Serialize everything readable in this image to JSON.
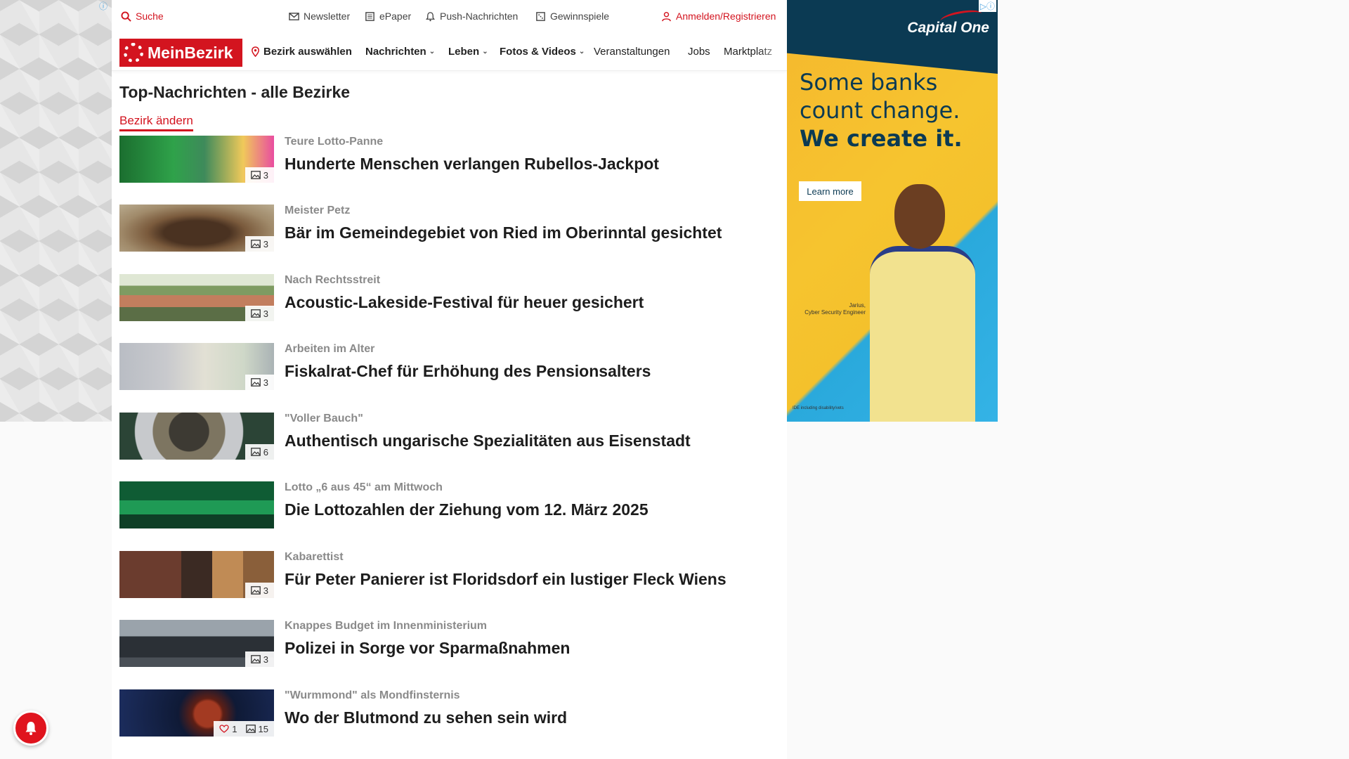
{
  "utility": {
    "search": "Suche",
    "newsletter": "Newsletter",
    "epaper": "ePaper",
    "push": "Push-Nachrichten",
    "gewinnspiele": "Gewinnspiele",
    "login": "Anmelden/Registrieren"
  },
  "nav": {
    "logo": "MeinBezirk",
    "bezirk": "Bezirk auswählen",
    "items": [
      "Nachrichten",
      "Leben",
      "Fotos & Videos",
      "Veranstaltungen",
      "Jobs",
      "Marktplatz"
    ]
  },
  "main": {
    "title": "Top-Nachrichten - alle Bezirke",
    "change_bezirk": "Bezirk ändern",
    "articles": [
      {
        "kicker": "Teure Lotto-Panne",
        "headline": "Hunderte Menschen verlangen Rubellos-Jackpot",
        "images": "3"
      },
      {
        "kicker": "Meister Petz",
        "headline": "Bär im Gemeindegebiet von Ried im Oberinntal gesichtet",
        "images": "3"
      },
      {
        "kicker": "Nach Rechtsstreit",
        "headline": "Acoustic-Lakeside-Festival für heuer gesichert",
        "images": "3"
      },
      {
        "kicker": "Arbeiten im Alter",
        "headline": "Fiskalrat-Chef für Erhöhung des Pensionsalters",
        "images": "3"
      },
      {
        "kicker": "\"Voller Bauch\"",
        "headline": "Authentisch ungarische Spezialitäten aus Eisenstadt",
        "images": "6"
      },
      {
        "kicker": "Lotto „6 aus 45“ am Mittwoch",
        "headline": "Die Lottozahlen der Ziehung vom 12. März 2025",
        "images": ""
      },
      {
        "kicker": "Kabarettist",
        "headline": "Für Peter Panierer ist Floridsdorf ein lustiger Fleck Wiens",
        "images": "3"
      },
      {
        "kicker": "Knappes Budget im Innenministerium",
        "headline": "Polizei in Sorge vor Sparmaßnahmen",
        "images": "3"
      },
      {
        "kicker": "\"Wurmmond\" als Mondfinsternis",
        "headline": "Wo der Blutmond zu sehen sein wird",
        "images": "15",
        "likes": "1"
      }
    ]
  },
  "ad": {
    "brand": "Capital One",
    "line1": "Some banks",
    "line2": "count change.",
    "line3": "We create it.",
    "cta": "Learn more",
    "caption_name": "Jarius,",
    "caption_role": "Cyber Security Engineer",
    "fine_print": "IDE including disability/vets"
  },
  "colors": {
    "brand_red": "#d3141f",
    "ad_navy": "#0b3a53",
    "ad_yellow": "#f5b82e",
    "ad_blue": "#2aa9dc"
  },
  "icons": [
    "search-icon",
    "mail-icon",
    "newspaper-icon",
    "bell-icon",
    "gift-icon",
    "user-icon",
    "location-pin-icon",
    "chevron-down-icon",
    "image-icon",
    "heart-icon",
    "info-icon"
  ]
}
